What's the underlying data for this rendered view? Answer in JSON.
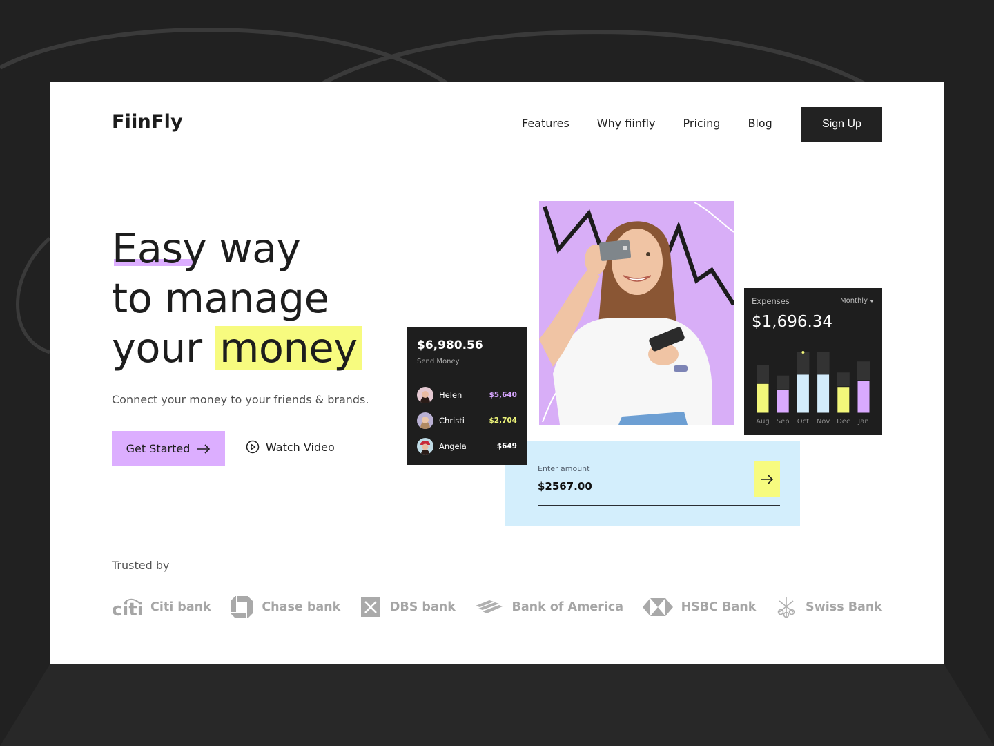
{
  "header": {
    "logo": "FiinFly",
    "nav": [
      "Features",
      "Why fiinfly",
      "Pricing",
      "Blog"
    ],
    "signup_label": "Sign Up"
  },
  "hero": {
    "title_line1_word1": "Easy",
    "title_line1_word2": "way",
    "title_line2": "to manage",
    "title_line3_word1": "your",
    "title_line3_highlight": "money",
    "subtitle": "Connect your money to your friends & brands.",
    "primary_cta": "Get Started",
    "secondary_cta": "Watch Video"
  },
  "send_money": {
    "total": "$6,980.56",
    "label": "Send Money",
    "contacts": [
      {
        "name": "Helen",
        "amount": "$5,640",
        "amount_color": "#d7a6ff"
      },
      {
        "name": "Christi",
        "amount": "$2,704",
        "amount_color": "#eef57a"
      },
      {
        "name": "Angela",
        "amount": "$649",
        "amount_color": "#ffffff"
      }
    ]
  },
  "amount_input": {
    "label": "Enter amount",
    "value": "$2567.00"
  },
  "expenses": {
    "title": "Expenses",
    "period": "Monthly",
    "amount": "$1,696.34"
  },
  "chart_data": {
    "type": "bar",
    "title": "Expenses",
    "categories": [
      "Aug",
      "Sep",
      "Oct",
      "Nov",
      "Dec",
      "Jan"
    ],
    "series": [
      {
        "name": "budget",
        "values": [
          0.78,
          0.61,
          1.0,
          1.0,
          0.66,
          0.84
        ],
        "color": "#333333"
      },
      {
        "name": "spent",
        "values": [
          0.48,
          0.38,
          0.63,
          0.63,
          0.43,
          0.53
        ],
        "colors": [
          "#f3f77a",
          "#d9a9ff",
          "#d3ecfb",
          "#d3ecfb",
          "#f3f77a",
          "#d9a9ff"
        ]
      }
    ],
    "highlight_category": "Oct",
    "ylim": [
      0,
      1
    ],
    "grid": false,
    "xlabel": "",
    "ylabel": ""
  },
  "trusted": {
    "label": "Trusted by",
    "brands": [
      {
        "name": "Citi bank",
        "icon": "citi-logo"
      },
      {
        "name": "Chase bank",
        "icon": "chase-logo"
      },
      {
        "name": "DBS bank",
        "icon": "dbs-logo"
      },
      {
        "name": "Bank of America",
        "icon": "bofa-logo"
      },
      {
        "name": "HSBC Bank",
        "icon": "hsbc-logo"
      },
      {
        "name": "Swiss Bank",
        "icon": "ubs-keys-logo"
      }
    ]
  }
}
